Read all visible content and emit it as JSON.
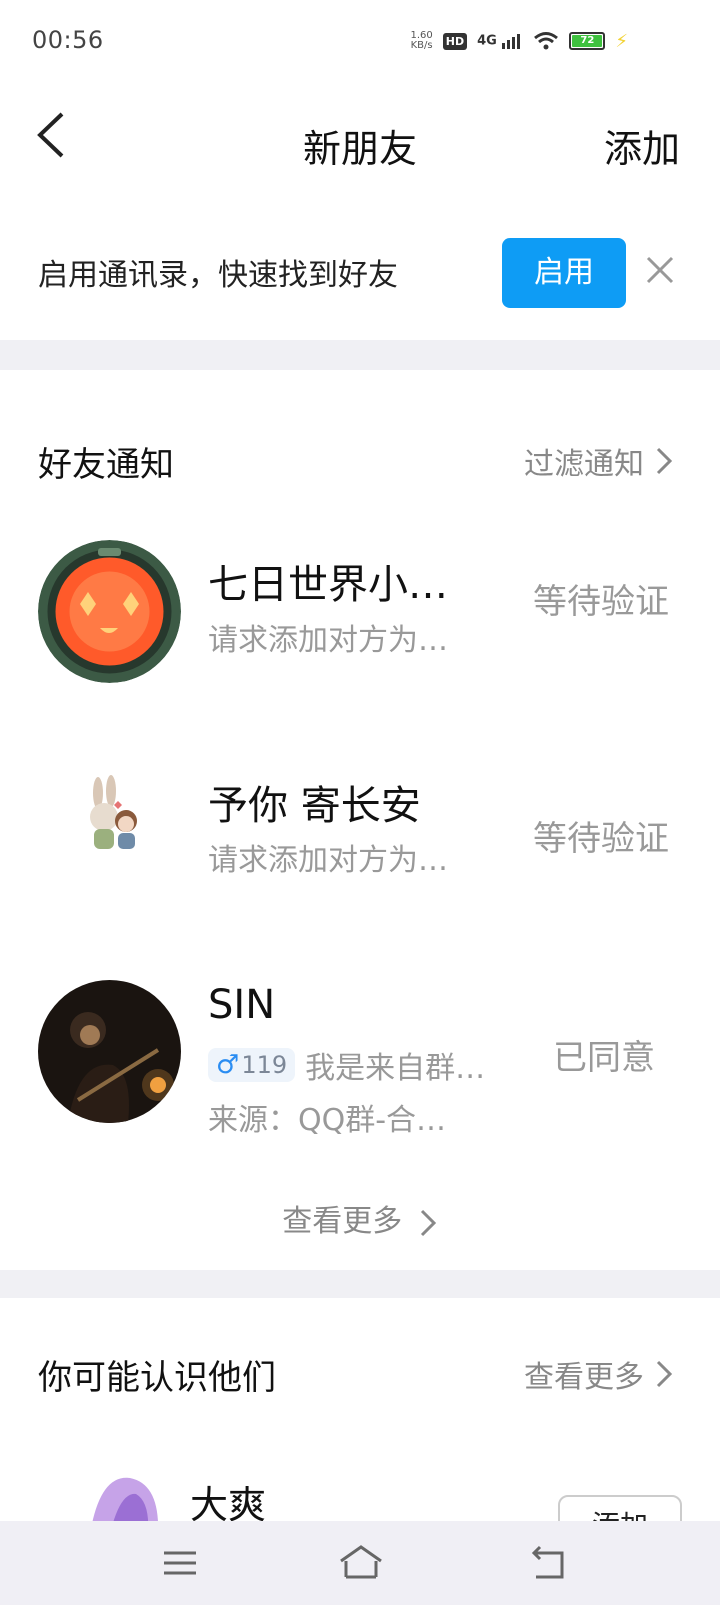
{
  "status_bar": {
    "time": "00:56",
    "net_speed_value": "1.60",
    "net_speed_unit": "KB/s",
    "hd": "HD",
    "signal": "4G",
    "battery": "72"
  },
  "nav": {
    "title": "新朋友",
    "add_label": "添加"
  },
  "banner": {
    "text": "启用通讯录，快速找到好友",
    "enable_label": "启用"
  },
  "notices": {
    "title": "好友通知",
    "filter_label": "过滤通知",
    "items": [
      {
        "name": "七日世界小…",
        "sub": "请求添加对方为…",
        "status": "等待验证"
      },
      {
        "name": "予你  寄长安",
        "sub": "请求添加对方为…",
        "status": "等待验证"
      },
      {
        "name": "SIN",
        "gender_badge": "119",
        "message": "我是来自群…",
        "source": "来源：QQ群-合…",
        "status": "已同意"
      }
    ],
    "see_more": "查看更多"
  },
  "suggestions": {
    "title": "你可能认识他们",
    "see_more": "查看更多",
    "items": [
      {
        "name": "大爽",
        "add_label": "添加"
      }
    ]
  },
  "colors": {
    "accent": "#0e9cf5",
    "divider": "#f0f0f4"
  }
}
